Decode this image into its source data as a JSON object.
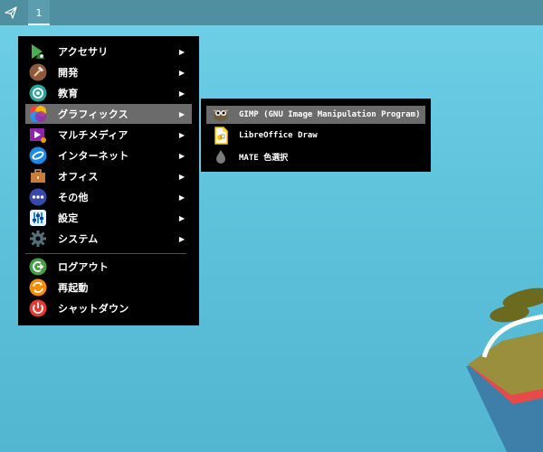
{
  "panel": {
    "launcher_icon": "paper-plane-icon",
    "workspace_label": "1"
  },
  "menu": {
    "items": [
      {
        "label": "アクセサリ",
        "icon": "accessories-icon",
        "has_submenu": true
      },
      {
        "label": "開発",
        "icon": "development-hammer-icon",
        "has_submenu": true
      },
      {
        "label": "教育",
        "icon": "education-icon",
        "has_submenu": true
      },
      {
        "label": "グラフィックス",
        "icon": "graphics-icon",
        "has_submenu": true,
        "active": true
      },
      {
        "label": "マルチメディア",
        "icon": "multimedia-icon",
        "has_submenu": true
      },
      {
        "label": "インターネット",
        "icon": "internet-icon",
        "has_submenu": true
      },
      {
        "label": "オフィス",
        "icon": "office-briefcase-icon",
        "has_submenu": true
      },
      {
        "label": "その他",
        "icon": "other-dots-icon",
        "has_submenu": true
      },
      {
        "label": "設定",
        "icon": "settings-sliders-icon",
        "has_submenu": true
      },
      {
        "label": "システム",
        "icon": "system-gear-icon",
        "has_submenu": true
      }
    ],
    "session_items": [
      {
        "label": "ログアウト",
        "icon": "logout-icon"
      },
      {
        "label": "再起動",
        "icon": "restart-icon"
      },
      {
        "label": "シャットダウン",
        "icon": "shutdown-icon"
      }
    ],
    "submenu_arrow": "▶"
  },
  "submenu": {
    "items": [
      {
        "label": "GIMP (GNU Image Manipulation Program)",
        "icon": "gimp-icon",
        "active": true
      },
      {
        "label": "LibreOffice Draw",
        "icon": "libreoffice-draw-icon"
      },
      {
        "label": "MATE 色選択",
        "icon": "color-picker-drop-icon"
      }
    ]
  },
  "colors": {
    "desktop": "#5bbfd9",
    "panel": "#4f8fa0",
    "menu_bg": "#000000",
    "highlight": "#6b6b6b"
  }
}
